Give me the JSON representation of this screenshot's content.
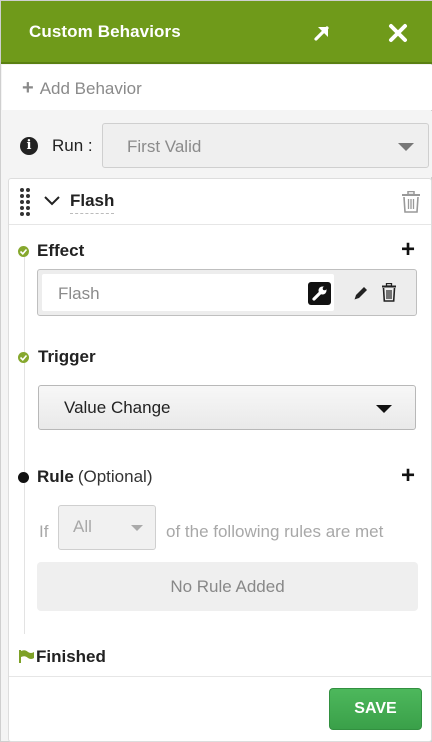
{
  "header": {
    "title": "Custom Behaviors",
    "expand_icon": "expand-arrow-icon",
    "close_icon": "close-icon",
    "color": "#6f9a1a"
  },
  "add_behavior": {
    "label": "Add Behavior"
  },
  "run": {
    "label": "Run :",
    "selected": "First Valid"
  },
  "behavior": {
    "name": "Flash",
    "effect": {
      "title": "Effect",
      "value": "Flash"
    },
    "trigger": {
      "title": "Trigger",
      "selected": "Value Change"
    },
    "rule": {
      "title": "Rule",
      "optional_label": "(Optional)",
      "if_label": "If",
      "match_selected": "All",
      "suffix": "of the following rules are met",
      "empty_text": "No Rule Added"
    },
    "finished_label": "Finished"
  },
  "footer": {
    "save_label": "SAVE",
    "save_color": "#3aa049"
  }
}
